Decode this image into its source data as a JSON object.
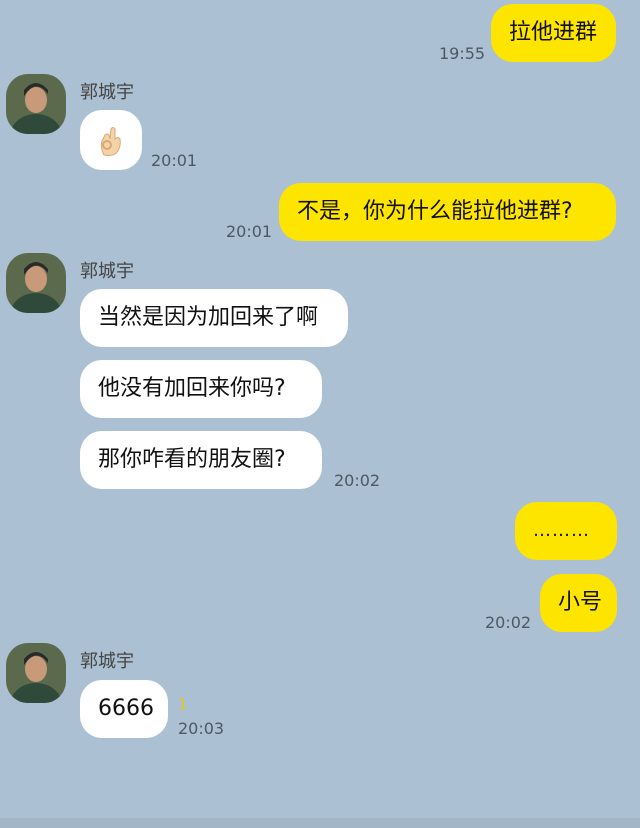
{
  "messages": {
    "m1": {
      "text": "拉他进群",
      "time": "19:55"
    },
    "m2": {
      "sender": "郭城宇",
      "emoji": "ok-hand-emoji",
      "time": "20:01"
    },
    "m3": {
      "text": "不是，你为什么能拉他进群?",
      "time": "20:01"
    },
    "m4": {
      "sender": "郭城宇",
      "lines": [
        "当然是因为加回来了啊",
        "他没有加回来你吗?",
        "那你咋看的朋友圈?"
      ],
      "time": "20:02"
    },
    "m5": {
      "lines": [
        "………",
        "小号"
      ],
      "time": "20:02"
    },
    "m6": {
      "sender": "郭城宇",
      "text": "6666",
      "unread": "1",
      "time": "20:03"
    }
  },
  "colors": {
    "background": "#abc0d2",
    "my_bubble": "#fee500",
    "other_bubble": "#ffffff",
    "unread": "#e8c800"
  }
}
